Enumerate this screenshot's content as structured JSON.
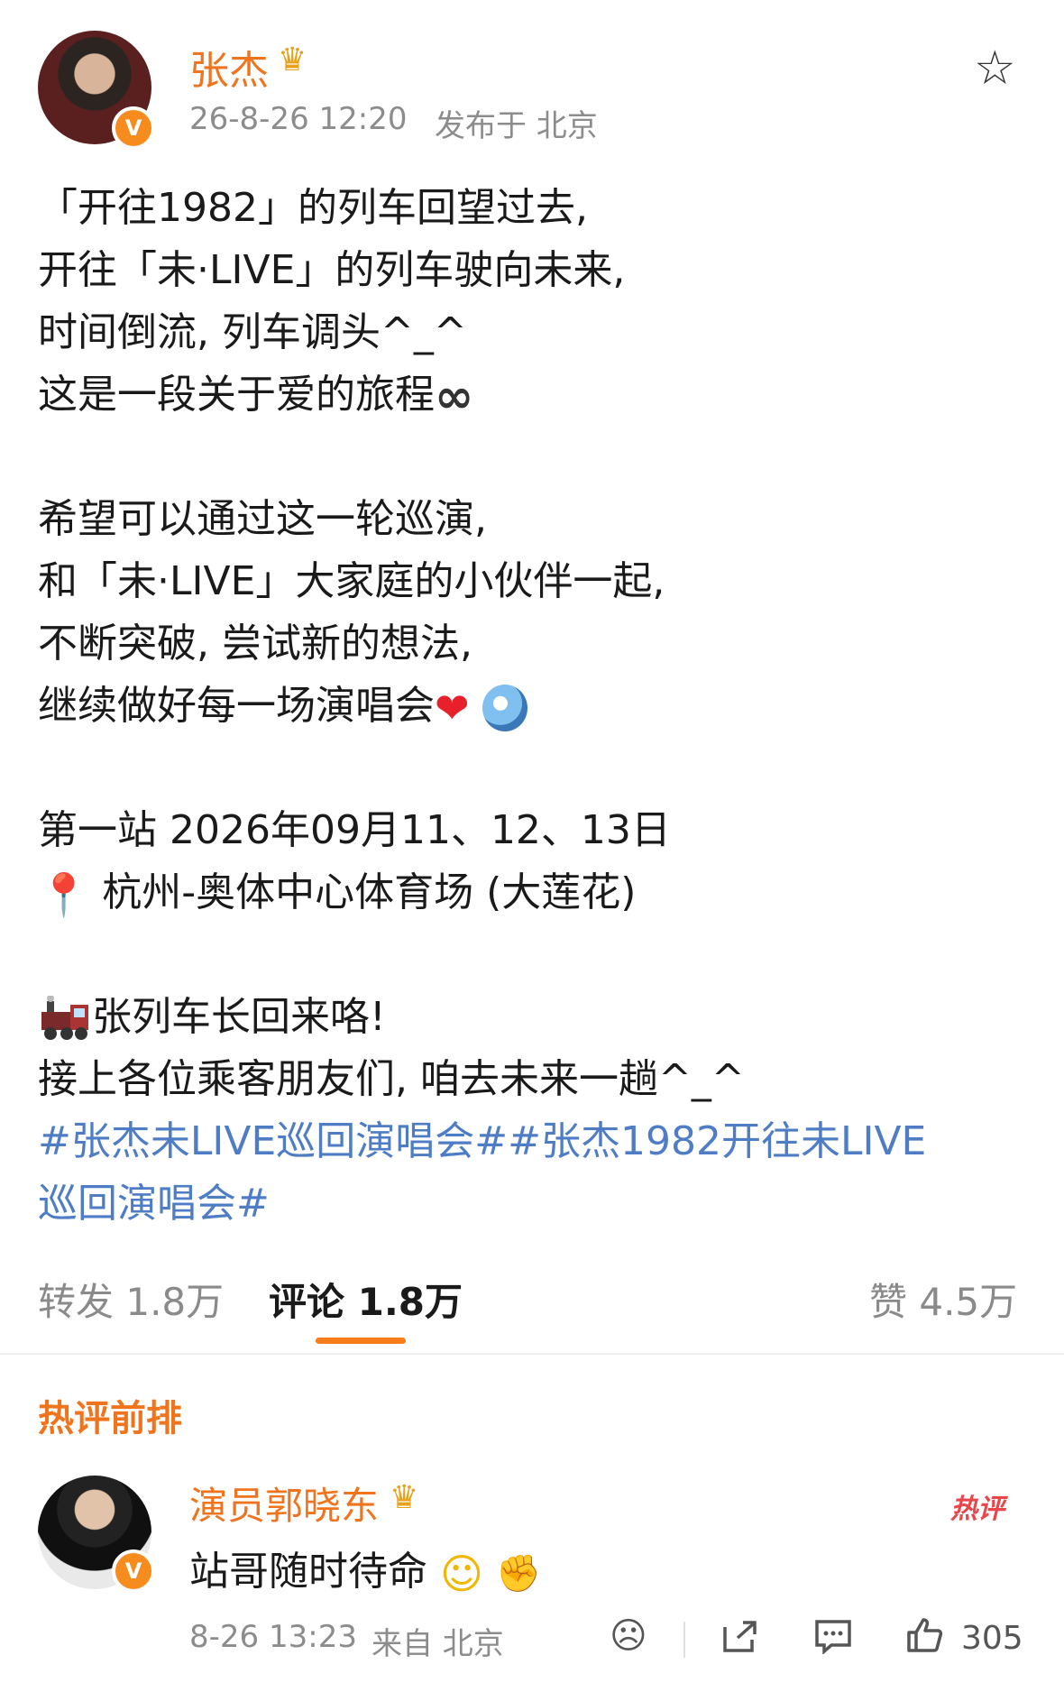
{
  "author": {
    "name": "张杰",
    "badge_icon": "crown-icon",
    "verified_mark": "V",
    "timestamp": "26-8-26 12:20",
    "location": "发布于 北京"
  },
  "post": {
    "lines": [
      "「开往1982」的列车回望过去,",
      "开往「未·LIVE」的列车驶向未来,",
      "时间倒流, 列车调头^_^",
      "这是一段关于爱的旅程",
      "",
      "希望可以通过这一轮巡演,",
      "和「未·LIVE」大家庭的小伙伴一起,",
      "不断突破, 尝试新的想法,",
      "继续做好每一场演唱会",
      "",
      "第一站 2026年09月11、12、13日",
      "杭州-奥体中心体育场 (大莲花)",
      "",
      "张列车长回来咯!",
      "接上各位乘客朋友们, 咱去未来一趟^_^"
    ],
    "hashtag_line1": "#张杰未LIVE巡回演唱会##张杰1982开往未LIVE",
    "hashtag_line2": "巡回演唱会#",
    "emojis": {
      "infinity": "∞",
      "heart": "❤",
      "pin": "📍"
    }
  },
  "tabs": {
    "repost": "转发 1.8万",
    "comments": "评论 1.8万",
    "likes": "赞 4.5万"
  },
  "hot_comments": {
    "title": "热评前排",
    "items": [
      {
        "name": "演员郭晓东",
        "text": "站哥随时待命",
        "badge": "热评",
        "time": "8-26 13:23",
        "location": "来自 北京",
        "likes": "305"
      }
    ]
  },
  "colors": {
    "accent": "#f0741e",
    "hashtag": "#4e7dc6",
    "meta": "#8c8c8c"
  }
}
